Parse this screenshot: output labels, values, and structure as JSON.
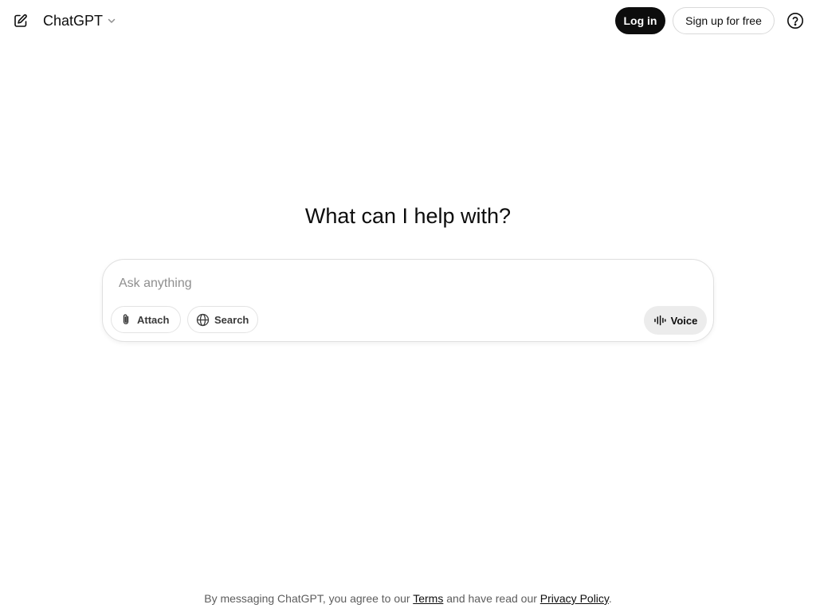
{
  "header": {
    "model_name": "ChatGPT",
    "login_label": "Log in",
    "signup_label": "Sign up for free",
    "icons": {
      "new_chat": "new-chat-icon",
      "model_dropdown": "chevron-down-icon",
      "help": "help-icon"
    }
  },
  "main": {
    "heading": "What can I help with?",
    "composer": {
      "placeholder": "Ask anything",
      "value": "",
      "attach_label": "Attach",
      "search_label": "Search",
      "voice_label": "Voice"
    }
  },
  "footer": {
    "text_before": "By messaging ChatGPT, you agree to our ",
    "terms_label": "Terms",
    "text_middle": " and have read our ",
    "privacy_label": "Privacy Policy",
    "text_after": "."
  },
  "colors": {
    "primary_button": "#0d0d0d",
    "voice_button_bg": "#ececec",
    "border": "#e0e0e0"
  }
}
